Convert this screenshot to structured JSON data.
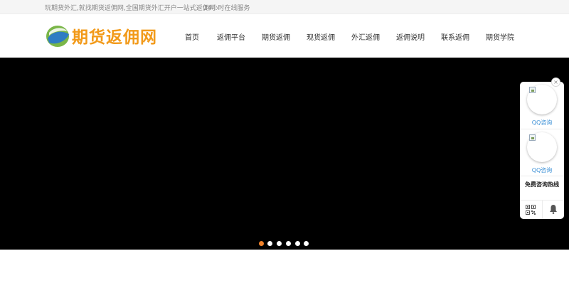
{
  "topbar": {
    "tagline": "玩期货外汇,就找期货返佣网,全国期货外汇开户一站式返佣网.",
    "service": "24小时在线服务"
  },
  "logo": {
    "text": "期货返佣网",
    "icon": "globe-logo-icon"
  },
  "nav": {
    "items": [
      {
        "label": "首页"
      },
      {
        "label": "返佣平台"
      },
      {
        "label": "期货返佣"
      },
      {
        "label": "现货返佣"
      },
      {
        "label": "外汇返佣"
      },
      {
        "label": "返佣说明"
      },
      {
        "label": "联系返佣"
      },
      {
        "label": "期货学院"
      }
    ]
  },
  "banner": {
    "background": "#000000",
    "slide_count": 6,
    "active_slide": 1
  },
  "float_panel": {
    "close_icon": "close-icon",
    "qq": [
      {
        "label": "QQ咨询"
      },
      {
        "label": "QQ咨询"
      }
    ],
    "hotline_label": "免费咨询热线",
    "qr_icon": "qr-code-icon",
    "bell_icon": "bell-icon"
  },
  "colors": {
    "accent": "#f0822a",
    "logo_orange": "#f29a1a",
    "link_blue": "#3a8fd6"
  }
}
